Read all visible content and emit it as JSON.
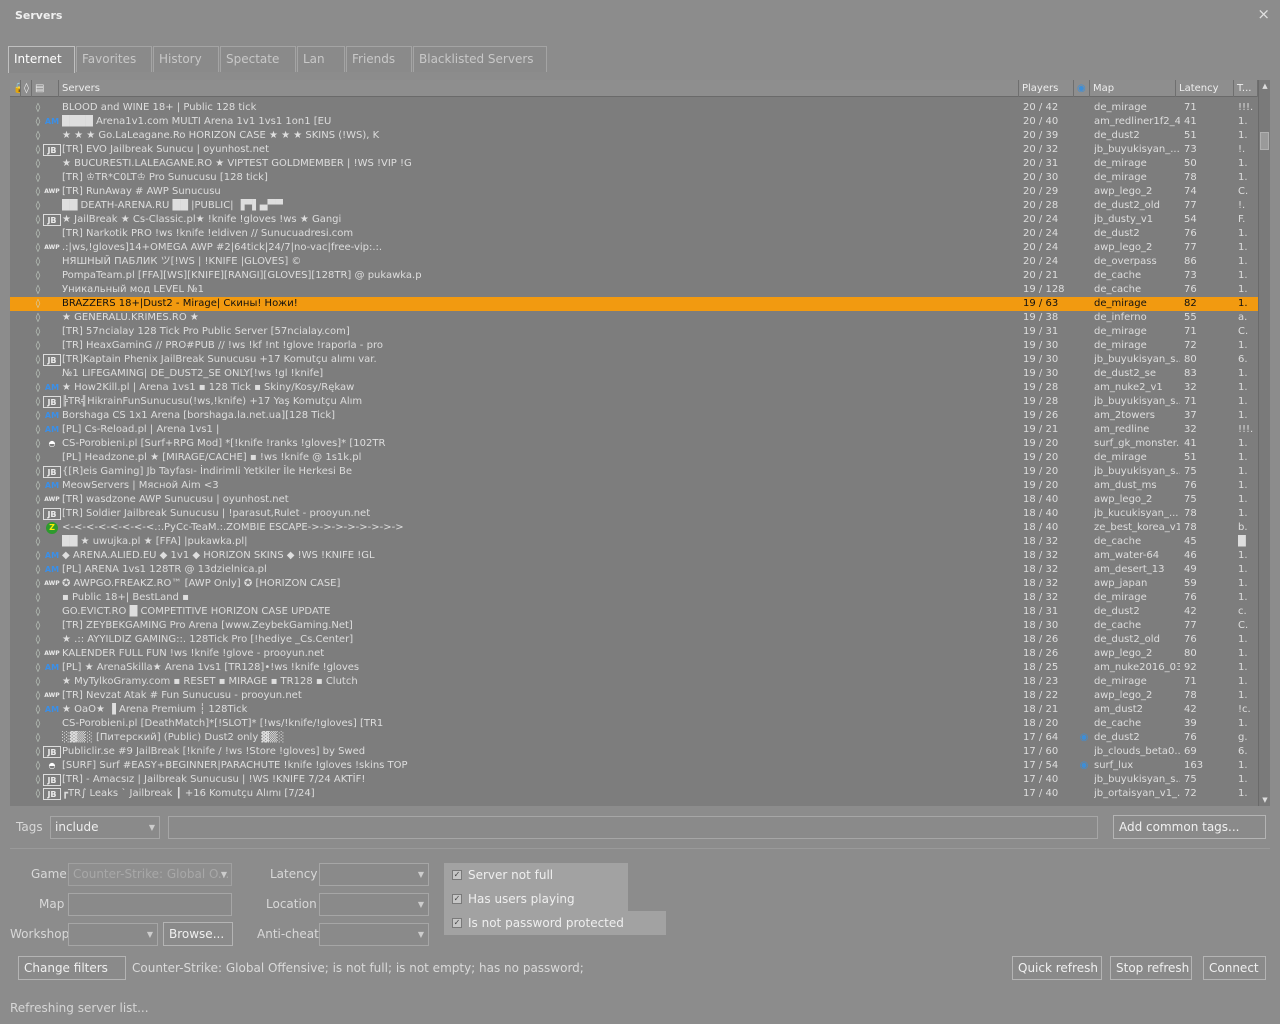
{
  "window": {
    "title": "Servers",
    "close_glyph": "×"
  },
  "tabs": [
    "Internet",
    "Favorites",
    "History",
    "Spectate",
    "Lan",
    "Friends",
    "Blacklisted Servers"
  ],
  "active_tab": 0,
  "columns": {
    "servers": "Servers",
    "players": "Players",
    "map": "Map",
    "latency": "Latency",
    "tags": "T..."
  },
  "colors": {
    "selected_row": "#f29a10",
    "am_badge": "#3a8fe8",
    "steam_icon": "#3d8ed8"
  },
  "rows": [
    {
      "badge": "",
      "name": "BLOOD and WINE 18+ | Public 128 tick",
      "players": "20 / 42",
      "steam": false,
      "map": "de_mirage",
      "latency": "71",
      "tags": "!!!."
    },
    {
      "badge": "AM",
      "name": "████ Arena1v1.com MULTI Arena 1v1 1vs1 1on1 [EU",
      "players": "20 / 40",
      "steam": false,
      "map": "am_redliner1f2_4...",
      "latency": "41",
      "tags": "1."
    },
    {
      "badge": "",
      "name": "★ ★ ★  Go.LaLeagane.Ro HORIZON CASE ★ ★ ★  SKINS (!WS), K",
      "players": "20 / 39",
      "steam": false,
      "map": "de_dust2",
      "latency": "51",
      "tags": "1."
    },
    {
      "badge": "JB",
      "name": "[TR] EVO Jailbreak Sunucu | oyunhost.net",
      "players": "20 / 32",
      "steam": false,
      "map": "jb_buyukisyan_...",
      "latency": "73",
      "tags": "!."
    },
    {
      "badge": "",
      "name": "★  BUCURESTI.LALEAGANE.RO ★  VIPTEST GOLDMEMBER | !WS !VIP !G",
      "players": "20 / 31",
      "steam": false,
      "map": "de_mirage",
      "latency": "50",
      "tags": "1."
    },
    {
      "badge": "",
      "name": "[TR] ♔TR*C0LT♔ Pro Sunucusu [128 tick]",
      "players": "20 / 30",
      "steam": false,
      "map": "de_mirage",
      "latency": "78",
      "tags": "1."
    },
    {
      "badge": "AWP",
      "name": "[TR] RunAway # AWP Sunucusu",
      "players": "20 / 29",
      "steam": false,
      "map": "awp_lego_2",
      "latency": "74",
      "tags": "C."
    },
    {
      "badge": "",
      "name": "██ DEATH-ARENA.RU ██ |PUBLIC| ▐▀▌▄▀▀",
      "players": "20 / 28",
      "steam": false,
      "map": "de_dust2_old",
      "latency": "77",
      "tags": "!."
    },
    {
      "badge": "JB",
      "name": "★ JailBreak ★ Cs-Classic.pl★ !knife !gloves !ws ★  Gangi",
      "players": "20 / 24",
      "steam": false,
      "map": "jb_dusty_v1",
      "latency": "54",
      "tags": "F."
    },
    {
      "badge": "",
      "name": "[TR] Narkotik PRO !ws !knife !eldiven // Sunucuadresi.com",
      "players": "20 / 24",
      "steam": false,
      "map": "de_dust2",
      "latency": "76",
      "tags": "1."
    },
    {
      "badge": "AWP",
      "name": ".:|ws,!gloves]14+OMEGA AWP #2|64tick|24/7|no-vac|free-vip:.:.",
      "players": "20 / 24",
      "steam": false,
      "map": "awp_lego_2",
      "latency": "77",
      "tags": "1."
    },
    {
      "badge": "",
      "name": "НЯШНЫЙ ПАБЛИК ツ[!WS | !KNIFE |GLOVES] ©",
      "players": "20 / 24",
      "steam": false,
      "map": "de_overpass",
      "latency": "86",
      "tags": "1."
    },
    {
      "badge": "",
      "name": "PompaTeam.pl [FFA][WS][KNIFE][RANGI][GLOVES][128TR] @ pukawka.p",
      "players": "20 / 21",
      "steam": false,
      "map": "de_cache",
      "latency": "73",
      "tags": "1."
    },
    {
      "badge": "",
      "name": "Уникальный мод LEVEL №1",
      "players": "19 / 128",
      "steam": false,
      "map": "de_cache",
      "latency": "76",
      "tags": "1."
    },
    {
      "badge": "",
      "name": "BRAZZERS 18+|Dust2 - Mirage| Скины! Ножи!",
      "players": "19 / 63",
      "steam": false,
      "map": "de_mirage",
      "latency": "82",
      "tags": "1.",
      "selected": true
    },
    {
      "badge": "",
      "name": "★  GENERALU.KRIMES.RO ★",
      "players": "19 / 38",
      "steam": false,
      "map": "de_inferno",
      "latency": "55",
      "tags": "a."
    },
    {
      "badge": "",
      "name": "[TR] 57ncialay 128 Tick Pro Public Server [57ncialay.com]",
      "players": "19 / 31",
      "steam": false,
      "map": "de_mirage",
      "latency": "71",
      "tags": "C."
    },
    {
      "badge": "",
      "name": "[TR] HeaxGaminG // PRO#PUB // !ws !kf !nt !glove !raporla - pro",
      "players": "19 / 30",
      "steam": false,
      "map": "de_mirage",
      "latency": "72",
      "tags": "1."
    },
    {
      "badge": "JB",
      "name": "[TR]Kaptain Phenix JailBreak Sunucusu +17 Komutçu alımı var.",
      "players": "19 / 30",
      "steam": false,
      "map": "jb_buyukisyan_s...",
      "latency": "80",
      "tags": "6."
    },
    {
      "badge": "",
      "name": "№1 LIFEGAMING| DE_DUST2_SE ONLY[!ws !gl !knife]",
      "players": "19 / 30",
      "steam": false,
      "map": "de_dust2_se",
      "latency": "83",
      "tags": "1."
    },
    {
      "badge": "AM",
      "name": "★  How2Kill.pl | Arena 1vs1 ▪ 128 Tick ▪ Skiny/Kosy/Rękaw",
      "players": "19 / 28",
      "steam": false,
      "map": "am_nuke2_v1",
      "latency": "32",
      "tags": "1."
    },
    {
      "badge": "JB",
      "name": "╠TR╣HikrainFunSunucusu(!ws,!knife) +17 Yaş Komutçu Alım",
      "players": "19 / 28",
      "steam": false,
      "map": "jb_buyukisyan_s...",
      "latency": "71",
      "tags": "1."
    },
    {
      "badge": "AM",
      "name": "Borshaga CS 1x1 Arena [borshaga.la.net.ua][128 Tick]",
      "players": "19 / 26",
      "steam": false,
      "map": "am_2towers",
      "latency": "37",
      "tags": "1."
    },
    {
      "badge": "AM",
      "name": "[PL] Cs-Reload.pl | Arena 1vs1 |",
      "players": "19 / 21",
      "steam": false,
      "map": "am_redline",
      "latency": "32",
      "tags": "!!!."
    },
    {
      "badge": "S",
      "name": "CS-Porobieni.pl [Surf+RPG Mod] *[!knife !ranks !gloves]* [102TR",
      "players": "19 / 20",
      "steam": false,
      "map": "surf_gk_monster...",
      "latency": "41",
      "tags": "1."
    },
    {
      "badge": "",
      "name": "[PL] Headzone.pl ★  [MIRAGE/CACHE] ▪ !ws !knife @ 1s1k.pl",
      "players": "19 / 20",
      "steam": false,
      "map": "de_mirage",
      "latency": "51",
      "tags": "1."
    },
    {
      "badge": "JB",
      "name": "{[R]eis Gaming] Jb Tayfası- İndirimli Yetkiler İle  Herkesi Be",
      "players": "19 / 20",
      "steam": false,
      "map": "jb_buyukisyan_s...",
      "latency": "75",
      "tags": "1."
    },
    {
      "badge": "AM",
      "name": "MeowServers | Мясной Aim <3",
      "players": "19 / 20",
      "steam": false,
      "map": "am_dust_ms",
      "latency": "76",
      "tags": "1."
    },
    {
      "badge": "AWP",
      "name": "[TR] wasdzone AWP Sunucusu | oyunhost.net",
      "players": "18 / 40",
      "steam": false,
      "map": "awp_lego_2",
      "latency": "75",
      "tags": "1."
    },
    {
      "badge": "JB",
      "name": "[TR] Soldier Jailbreak Sunucusu | !parasut,Rulet - prooyun.net",
      "players": "18 / 40",
      "steam": false,
      "map": "jb_kucukisyan_...",
      "latency": "78",
      "tags": "1."
    },
    {
      "badge": "Z",
      "name": "<-<-<-<-<-<-<-<.:.PyCc-TeaM.:.ZOMBIE ESCAPE->->->->->->->->",
      "players": "18 / 40",
      "steam": false,
      "map": "ze_best_korea_v1",
      "latency": "78",
      "tags": "b."
    },
    {
      "badge": "",
      "name": "██ ★  uwujka.pl ★  [FFA] |pukawka.pl|",
      "players": "18 / 32",
      "steam": false,
      "map": "de_cache",
      "latency": "45",
      "tags": "█"
    },
    {
      "badge": "AM",
      "name": "◆  ARENA.ALIED.EU ◆  1v1 ◆  HORIZON SKINS ◆  !WS !KNIFE !GL",
      "players": "18 / 32",
      "steam": false,
      "map": "am_water-64",
      "latency": "46",
      "tags": "1."
    },
    {
      "badge": "AM",
      "name": "[PL]     ARENA 1vs1     128TR      @      13dzielnica.pl",
      "players": "18 / 32",
      "steam": false,
      "map": "am_desert_13",
      "latency": "49",
      "tags": "1."
    },
    {
      "badge": "AWP",
      "name": "✪ AWPGO.FREAKZ.RO™ [AWP Only] ✪ [HORIZON CASE]",
      "players": "18 / 32",
      "steam": false,
      "map": "awp_japan",
      "latency": "59",
      "tags": "1."
    },
    {
      "badge": "",
      "name": "▪ Public 18+| BestLand ▪",
      "players": "18 / 32",
      "steam": false,
      "map": "de_mirage",
      "latency": "76",
      "tags": "1."
    },
    {
      "badge": "",
      "name": "GO.EVICT.RO █ COMPETITIVE HORIZON CASE UPDATE",
      "players": "18 / 31",
      "steam": false,
      "map": "de_dust2",
      "latency": "42",
      "tags": "c."
    },
    {
      "badge": "",
      "name": " [TR] ZEYBEKGAMING Pro Arena [www.ZeybekGaming.Net]",
      "players": "18 / 30",
      "steam": false,
      "map": "de_cache",
      "latency": "77",
      "tags": "C."
    },
    {
      "badge": "",
      "name": "★ .:: AYYILDIZ GAMING::. 128Tick Pro [!hediye _Cs.Center]",
      "players": "18 / 26",
      "steam": false,
      "map": "de_dust2_old",
      "latency": "76",
      "tags": "1."
    },
    {
      "badge": "AWP",
      "name": "KALENDER FULL FUN !ws !knife !glove - prooyun.net",
      "players": "18 / 26",
      "steam": false,
      "map": "awp_lego_2",
      "latency": "80",
      "tags": "1."
    },
    {
      "badge": "AM",
      "name": "[PL] ★ ArenaSkilla★  Arena 1vs1 [TR128]•!ws !knife !gloves",
      "players": "18 / 25",
      "steam": false,
      "map": "am_nuke2016_03",
      "latency": "92",
      "tags": "1."
    },
    {
      "badge": "",
      "name": "★  MyTylkoGramy.com ▪ RESET ▪ MIRAGE ▪ TR128 ▪ Clutch",
      "players": "18 / 23",
      "steam": false,
      "map": "de_mirage",
      "latency": "71",
      "tags": "1."
    },
    {
      "badge": "AWP",
      "name": "[TR] Nevzat Atak # Fun Sunucusu - prooyun.net",
      "players": "18 / 22",
      "steam": false,
      "map": "awp_lego_2",
      "latency": "78",
      "tags": "1."
    },
    {
      "badge": "AM",
      "name": "★ OaO★  ▐ Arena Premium ┆ 128Tick",
      "players": "18 / 21",
      "steam": false,
      "map": "am_dust2",
      "latency": "42",
      "tags": "!c."
    },
    {
      "badge": "",
      "name": "CS-Porobieni.pl [DeathMatch]*[!SLOT]* [!ws/!knife/!gloves] [TR1",
      "players": "18 / 20",
      "steam": false,
      "map": "de_cache",
      "latency": "39",
      "tags": "1."
    },
    {
      "badge": "",
      "name": "░▓▒░ [Питерский] (Public) Dust2 only ▓▒░",
      "players": "17 / 64",
      "steam": true,
      "map": "de_dust2",
      "latency": "76",
      "tags": "g."
    },
    {
      "badge": "JB",
      "name": "Publiclir.se #9 JailBreak [!knife / !ws !Store !gloves] by Swed",
      "players": "17 / 60",
      "steam": false,
      "map": "jb_clouds_beta0...",
      "latency": "69",
      "tags": "6."
    },
    {
      "badge": "S",
      "name": "[SURF] Surf #EASY+BEGINNER|PARACHUTE !knife !gloves !skins TOP",
      "players": "17 / 54",
      "steam": true,
      "map": "surf_lux",
      "latency": "163",
      "tags": "1."
    },
    {
      "badge": "JB",
      "name": "[TR] - Amacsız | Jailbreak Sunucusu | !WS !KNIFE 7/24 AKTİF!",
      "players": "17 / 40",
      "steam": false,
      "map": "jb_buyukisyan_s...",
      "latency": "75",
      "tags": "1."
    },
    {
      "badge": "JB",
      "name": "┏TR∫ Leaks ` Jailbreak   ┃ +16 Komutçu Alımı  [7/24]",
      "players": "17 / 40",
      "steam": false,
      "map": "jb_ortaisyan_v1_...",
      "latency": "72",
      "tags": "1."
    }
  ],
  "tags_bar": {
    "label": "Tags",
    "mode": "include",
    "tags_value": "",
    "add_common": "Add common tags..."
  },
  "filters": {
    "game_label": "Game",
    "game_value": "Counter-Strike: Global O...",
    "map_label": "Map",
    "map_value": "",
    "workshop_label": "Workshop",
    "workshop_value": "",
    "browse": "Browse...",
    "latency_label": "Latency",
    "latency_value": "",
    "location_label": "Location",
    "location_value": "",
    "anticheat_label": "Anti-cheat",
    "anticheat_value": "",
    "not_full": "Server not full",
    "has_users": "Has users playing",
    "no_password": "Is not password protected"
  },
  "actions": {
    "change_filters": "Change filters",
    "summary": "Counter-Strike: Global Offensive; is not full; is not empty; has no password;",
    "quick_refresh": "Quick refresh",
    "stop_refresh": "Stop refresh",
    "connect": "Connect"
  },
  "status": "Refreshing server list..."
}
